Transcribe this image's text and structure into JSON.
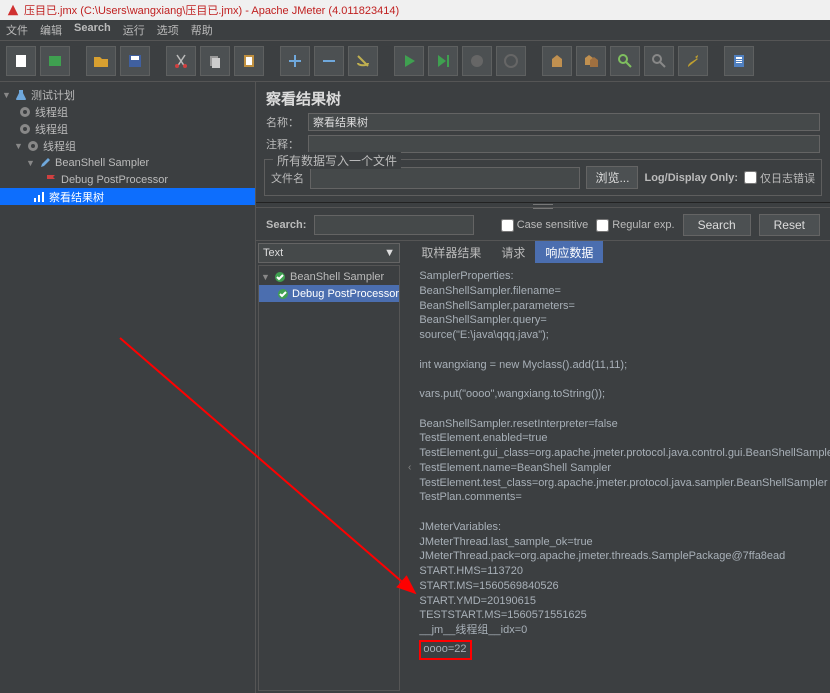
{
  "title": "压目已.jmx (C:\\Users\\wangxiang\\压目已.jmx) - Apache JMeter (4.011823414)",
  "menu": {
    "file": "文件",
    "edit": "编辑",
    "search": "Search",
    "run": "运行",
    "options": "选项",
    "help": "帮助"
  },
  "tree": {
    "plan": "测试计划",
    "tg1": "线程组",
    "tg2": "线程组",
    "tg3": "线程组",
    "sampler": "BeanShell Sampler",
    "debug": "Debug PostProcessor",
    "listener": "察看结果树"
  },
  "panel": {
    "title": "察看结果树",
    "name_label": "名称：",
    "name_value": "察看结果树",
    "comments_label": "注释：",
    "fieldset_legend": "所有数据写入一个文件",
    "file_label": "文件名",
    "browse_btn": "浏览...",
    "log_display_label": "Log/Display Only:",
    "errors_only_label": "仅日志错误",
    "search_label": "Search:",
    "case_label": "Case sensitive",
    "regex_label": "Regular exp.",
    "search_btn": "Search",
    "reset_btn": "Reset"
  },
  "combo": {
    "value": "Text"
  },
  "result_tree": {
    "root": "BeanShell Sampler",
    "child": "Debug PostProcessor"
  },
  "tabs": {
    "sampler": "取样器结果",
    "request": "请求",
    "response": "响应数据"
  },
  "response": {
    "l1": "SamplerProperties:",
    "l2": "BeanShellSampler.filename=",
    "l3": "BeanShellSampler.parameters=",
    "l4": "BeanShellSampler.query=",
    "l5": "source(\"E:\\java\\qqq.java\");",
    "l6": "",
    "l7": "int wangxiang = new Myclass().add(11,11);",
    "l8": "",
    "l9": "vars.put(\"oooo\",wangxiang.toString());",
    "l10": "",
    "l11": "BeanShellSampler.resetInterpreter=false",
    "l12": "TestElement.enabled=true",
    "l13": "TestElement.gui_class=org.apache.jmeter.protocol.java.control.gui.BeanShellSamplerGui",
    "l14": "TestElement.name=BeanShell Sampler",
    "l15": "TestElement.test_class=org.apache.jmeter.protocol.java.sampler.BeanShellSampler",
    "l16": "TestPlan.comments=",
    "l17": "",
    "l18": "JMeterVariables:",
    "l19": "JMeterThread.last_sample_ok=true",
    "l20": "JMeterThread.pack=org.apache.jmeter.threads.SamplePackage@7ffa8ead",
    "l21": "START.HMS=113720",
    "l22": "START.MS=1560569840526",
    "l23": "START.YMD=20190615",
    "l24": "TESTSTART.MS=1560571551625",
    "l25": "__jm__线程组__idx=0",
    "highlight": "oooo=22"
  }
}
